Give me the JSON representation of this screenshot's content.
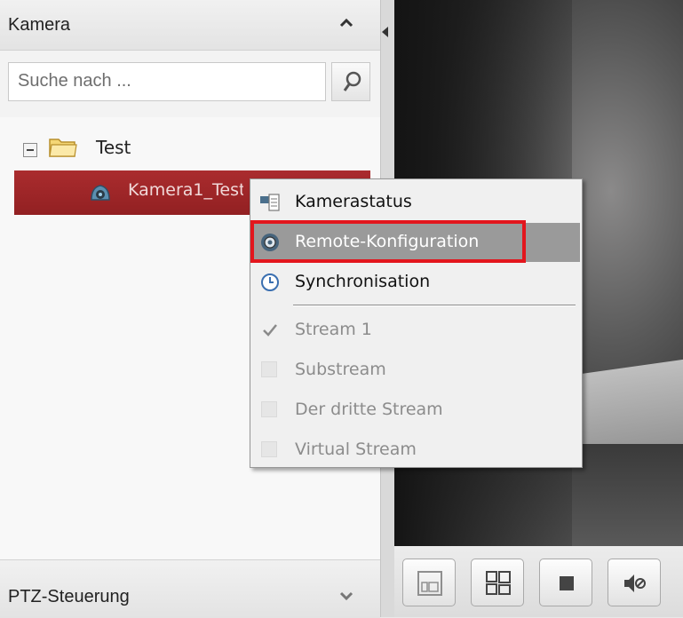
{
  "camera_panel": {
    "title": "Kamera",
    "search": {
      "placeholder": "Suche nach ...",
      "value": ""
    },
    "tree": {
      "group_label": "Test",
      "camera_label": "Kamera1_Test"
    }
  },
  "ptz_panel": {
    "title": "PTZ-Steuerung"
  },
  "context_menu": {
    "items": [
      {
        "label": "Kamerastatus",
        "icon": "camera-status-icon",
        "enabled": true
      },
      {
        "label": "Remote-Konfiguration",
        "icon": "remote-config-gear-icon",
        "enabled": true,
        "highlighted": true
      },
      {
        "label": "Synchronisation",
        "icon": "sync-clock-icon",
        "enabled": true
      }
    ],
    "streams": [
      {
        "label": "Stream 1",
        "checked": true
      },
      {
        "label": "Substream",
        "checked": false
      },
      {
        "label": "Der dritte Stream",
        "checked": false
      },
      {
        "label": "Virtual Stream",
        "checked": false
      }
    ]
  },
  "toolbar": {
    "buttons": [
      "window-layout-icon",
      "window-division-icon",
      "stop-icon",
      "mute-audio-icon"
    ]
  },
  "colors": {
    "selected_row": "#9e2628",
    "menu_highlight": "#9a9a9a",
    "annotation_red": "#e3161d"
  }
}
